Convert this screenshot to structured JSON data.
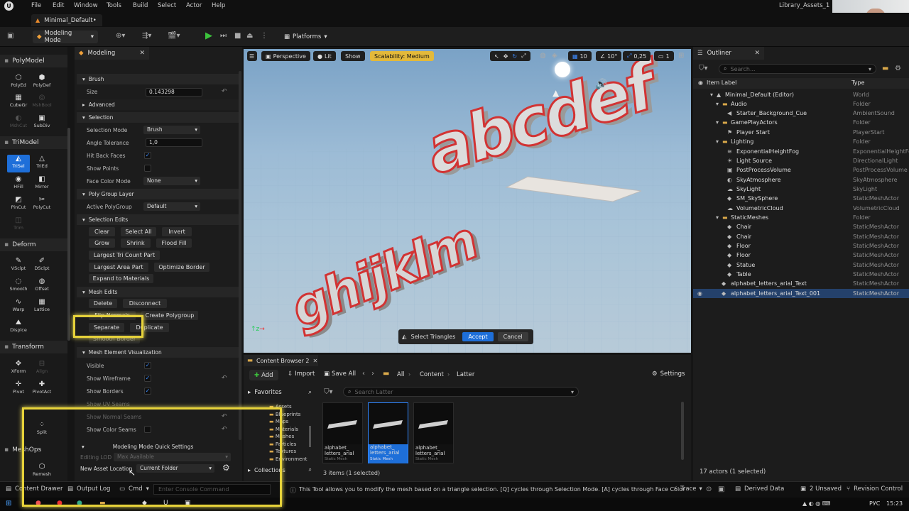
{
  "menu": {
    "items": [
      "File",
      "Edit",
      "Window",
      "Tools",
      "Build",
      "Select",
      "Actor",
      "Help"
    ],
    "project": "Library_Assets_1"
  },
  "level_tab": "Minimal_Default•",
  "toolbar": {
    "mode": "Modeling Mode",
    "platforms": "Platforms"
  },
  "palette": {
    "categories": {
      "polymodel": "PolyModel",
      "trimodel": "TriModel",
      "deform": "Deform",
      "transform": "Transform",
      "meshops": "MeshOps"
    },
    "tools": {
      "polyed": "PolyEd",
      "polydef": "PolyDef",
      "cubegr": "CubeGr",
      "meshbool": "MshBool",
      "meshcut": "MshCut",
      "subdiv": "SubDiv",
      "trisel": "TriSel",
      "tried": "TriEd",
      "hfill": "HFill",
      "mirror": "Mirror",
      "pincut": "PinCut",
      "polycut": "PolyCut",
      "trim": "Trim",
      "vsculpt": "VSclpt",
      "dsculpt": "DSclpt",
      "smooth": "Smooth",
      "offset": "Offset",
      "warp": "Warp",
      "lattice": "Lattice",
      "displace": "Displce",
      "xform": "XForm",
      "align": "Align",
      "pivot": "Pivot",
      "pivotact": "PivotAct",
      "split": "Split",
      "remesh": "Remesh"
    }
  },
  "details": {
    "tab": "Modeling",
    "sections": {
      "brush": "Brush",
      "advanced": "Advanced",
      "selection": "Selection",
      "polygroup": "Poly Group Layer",
      "selection_edits": "Selection Edits",
      "mesh_edits": "Mesh Edits",
      "mesh_vis": "Mesh Element Visualization",
      "quick_settings": "Modeling Mode Quick Settings"
    },
    "labels": {
      "size": "Size",
      "selection_mode": "Selection Mode",
      "angle_tolerance": "Angle Tolerance",
      "hit_back_faces": "Hit Back Faces",
      "show_points": "Show Points",
      "face_color_mode": "Face Color Mode",
      "active_polygroup": "Active PolyGroup",
      "visible": "Visible",
      "show_wireframe": "Show Wireframe",
      "show_borders": "Show Borders",
      "show_uv_seams": "Show UV Seams",
      "show_normal_seams": "Show Normal Seams",
      "show_color_seams": "Show Color Seams",
      "editing_lod": "Editing LOD",
      "new_asset_location": "New Asset Location"
    },
    "values": {
      "size": "0.143298",
      "selection_mode": "Brush",
      "angle_tolerance": "1,0",
      "face_color_mode": "None",
      "active_polygroup": "Default",
      "editing_lod": "Max Available",
      "new_asset_location": "Current Folder"
    },
    "buttons": {
      "clear": "Clear",
      "select_all": "Select All",
      "invert": "Invert",
      "grow": "Grow",
      "shrink": "Shrink",
      "flood_fill": "Flood Fill",
      "largest_tri": "Largest Tri Count Part",
      "largest_area": "Largest Area Part",
      "optimize_border": "Optimize Border",
      "expand_materials": "Expand to Materials",
      "delete": "Delete",
      "disconnect": "Disconnect",
      "flip_normals": "Flip Normals",
      "create_polygroup": "Create Polygroup",
      "separate": "Separate",
      "duplicate": "Duplicate",
      "smooth_border": "Smooth Border"
    }
  },
  "viewport": {
    "perspective": "Perspective",
    "lit": "Lit",
    "show": "Show",
    "scalability": "Scalability: Medium",
    "grid": "10",
    "angle": "10°",
    "scale": "0,25",
    "cam": "1",
    "select_triangles": "Select Triangles",
    "accept": "Accept",
    "cancel": "Cancel",
    "letters": [
      "abcdef",
      "ghijklm"
    ]
  },
  "content_browser": {
    "tab": "Content Browser 2",
    "add": "Add",
    "import": "Import",
    "save_all": "Save All",
    "path": [
      "All",
      "Content",
      "Latter"
    ],
    "settings": "Settings",
    "favorites": "Favorites",
    "search_placeholder": "Search Latter",
    "collections": "Collections",
    "folders": [
      "Assets",
      "Blueprints",
      "Maps",
      "Materials",
      "Meshes",
      "Particles",
      "Textures",
      "Environment"
    ],
    "assets": [
      {
        "name": "alphabet_ letters_arial",
        "type": "Static Mesh"
      },
      {
        "name": "alphabet_ letters_arial",
        "type": "Static Mesh"
      },
      {
        "name": "alphabet_ letters_arial",
        "type": "Static Mesh"
      }
    ],
    "count": "3 items (1 selected)"
  },
  "outliner": {
    "tab": "Outliner",
    "search_placeholder": "Search...",
    "col_label": "Item Label",
    "col_type": "Type",
    "rows": [
      {
        "name": "Minimal_Default (Editor)",
        "type": "World"
      },
      {
        "name": "Audio",
        "type": "Folder"
      },
      {
        "name": "Starter_Background_Cue",
        "type": "AmbientSound"
      },
      {
        "name": "GamePlayActors",
        "type": "Folder"
      },
      {
        "name": "Player Start",
        "type": "PlayerStart"
      },
      {
        "name": "Lighting",
        "type": "Folder"
      },
      {
        "name": "ExponentialHeightFog",
        "type": "ExponentialHeightFog"
      },
      {
        "name": "Light Source",
        "type": "DirectionalLight"
      },
      {
        "name": "PostProcessVolume",
        "type": "PostProcessVolume"
      },
      {
        "name": "SkyAtmosphere",
        "type": "SkyAtmosphere"
      },
      {
        "name": "SkyLight",
        "type": "SkyLight"
      },
      {
        "name": "SM_SkySphere",
        "type": "StaticMeshActor"
      },
      {
        "name": "VolumetricCloud",
        "type": "VolumetricCloud"
      },
      {
        "name": "StaticMeshes",
        "type": "Folder"
      },
      {
        "name": "Chair",
        "type": "StaticMeshActor"
      },
      {
        "name": "Chair",
        "type": "StaticMeshActor"
      },
      {
        "name": "Floor",
        "type": "StaticMeshActor"
      },
      {
        "name": "Floor",
        "type": "StaticMeshActor"
      },
      {
        "name": "Statue",
        "type": "StaticMeshActor"
      },
      {
        "name": "Table",
        "type": "StaticMeshActor"
      },
      {
        "name": "alphabet_letters_arial_Text",
        "type": "StaticMeshActor"
      },
      {
        "name": "alphabet_letters_arial_Text_001",
        "type": "StaticMeshActor"
      }
    ],
    "actor_count": "17 actors (1 selected)"
  },
  "status": {
    "content_drawer": "Content Drawer",
    "output_log": "Output Log",
    "cmd": "Cmd",
    "console_placeholder": "Enter Console Command",
    "hint": "This Tool allows you to modify the mesh based on a triangle selection. [Q] cycles through Selection Mode. [A] cycles through Face Color",
    "trace": "Trace",
    "derived_data": "Derived Data",
    "unsaved": "2 Unsaved",
    "revision_control": "Revision Control"
  },
  "taskbar": {
    "lang": "РУС",
    "time": "15:23"
  },
  "colors": {
    "accent": "#1e6fd9",
    "highlight": "#e6d23a",
    "scalability": "#e3b93a"
  }
}
